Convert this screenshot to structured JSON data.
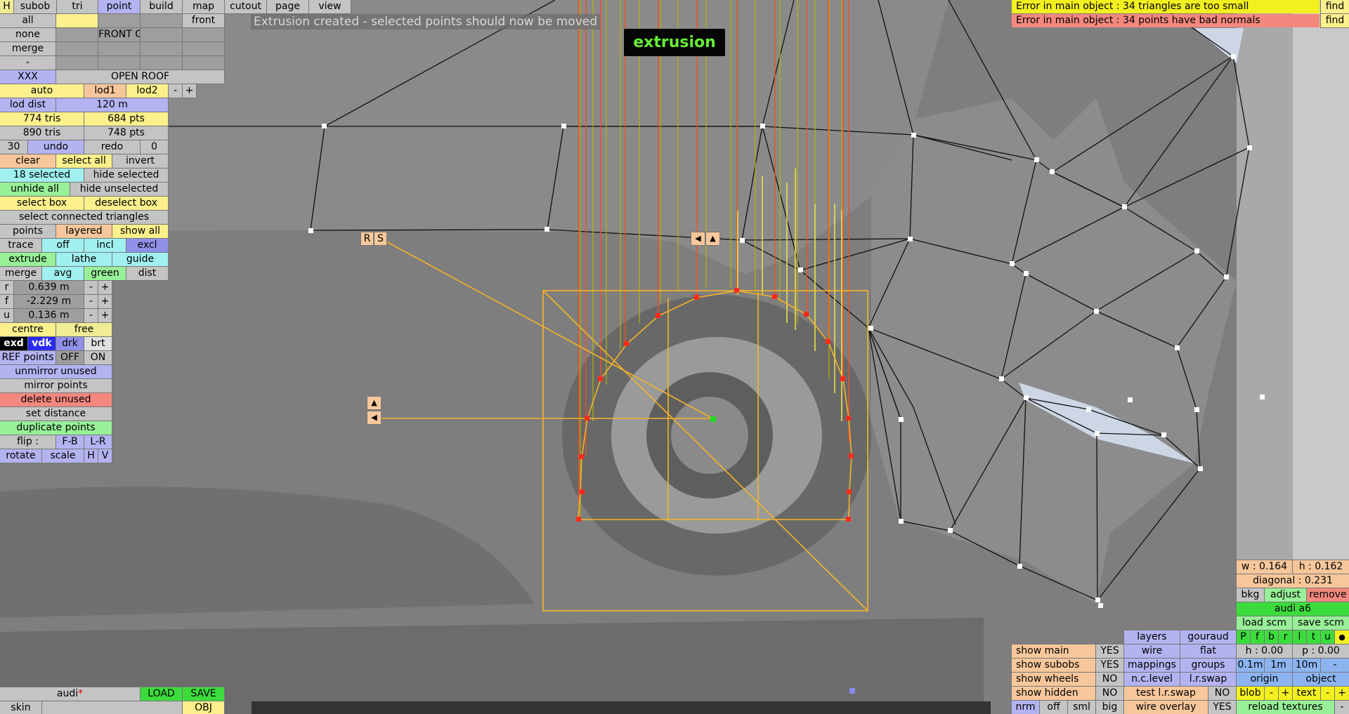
{
  "message": "Extrusion created - selected points should now be moved",
  "banner": "extrusion",
  "errors": [
    {
      "text": "Error in main object : 34 triangles are too small",
      "action": "find"
    },
    {
      "text": "Error in main object : 34 points have bad normals",
      "action": "find"
    }
  ],
  "menu": {
    "h": "H",
    "items": [
      "subob",
      "tri",
      "point",
      "build",
      "map",
      "cutout",
      "page",
      "view"
    ],
    "active": "point"
  },
  "selection_panel": {
    "all": "all",
    "none": "none",
    "merge": "merge",
    "dash": "-",
    "xxx": "XXX",
    "front": "front",
    "front_g": "FRONT G",
    "open_roof": "OPEN ROOF"
  },
  "lod": {
    "auto": "auto",
    "lod1": "lod1",
    "lod2": "lod2",
    "minus": "-",
    "plus": "+",
    "lod_dist_label": "lod dist",
    "lod_dist_value": "120 m"
  },
  "stats": {
    "tris1": "774 tris",
    "pts1": "684 pts",
    "tris2": "890 tris",
    "pts2": "748 pts"
  },
  "history": {
    "count": "30",
    "undo": "undo",
    "redo": "redo",
    "redo_count": "0"
  },
  "tools": {
    "clear": "clear",
    "select_all": "select all",
    "invert": "invert",
    "selected": "18 selected",
    "hide_selected": "hide selected",
    "unhide_all": "unhide all",
    "hide_unselected": "hide unselected",
    "select_box": "select box",
    "deselect_box": "deselect box",
    "select_connected": "select connected triangles",
    "points": "points",
    "layered": "layered",
    "show_all": "show all",
    "trace": "trace",
    "off": "off",
    "incl": "incl",
    "excl": "excl",
    "extrude": "extrude",
    "lathe": "lathe",
    "guide": "guide",
    "merge": "merge",
    "avg": "avg",
    "green": "green",
    "dist": "dist"
  },
  "coords": [
    {
      "axis": "r",
      "value": "0.639 m"
    },
    {
      "axis": "f",
      "value": "-2.229 m"
    },
    {
      "axis": "u",
      "value": "0.136 m"
    }
  ],
  "steppers": {
    "minus": "-",
    "plus": "+"
  },
  "pivot": {
    "centre": "centre",
    "free": "free"
  },
  "view_modes": {
    "exd": "exd",
    "vdk": "vdk",
    "drk": "drk",
    "brt": "brt"
  },
  "ref_points": {
    "label": "REF points",
    "off": "OFF",
    "on": "ON"
  },
  "ops": {
    "unmirror": "unmirror unused",
    "mirror": "mirror points",
    "delete": "delete unused",
    "set_distance": "set distance",
    "duplicate": "duplicate points",
    "flip": "flip :",
    "fb": "F-B",
    "lr": "L-R",
    "rotate": "rotate",
    "scale": "scale",
    "h": "H",
    "v": "V"
  },
  "handles": {
    "r": "R",
    "s": "S",
    "left": "◀",
    "up": "▲"
  },
  "file": {
    "name": "audi",
    "modified_mark": "*",
    "load": "LOAD",
    "save": "SAVE",
    "skin": "skin",
    "obj": "OBJ"
  },
  "selection_info": {
    "w": "w : 0.164",
    "h": "h : 0.162",
    "diagonal": "diagonal : 0.231",
    "bkg": "bkg",
    "adjust": "adjust",
    "remove": "remove",
    "model": "audi a6",
    "load_scm": "load scm",
    "save_scm": "save scm"
  },
  "render_modes": {
    "layers": "layers",
    "gouraud": "gouraud",
    "wire": "wire",
    "flat": "flat",
    "mappings": "mappings",
    "groups": "groups",
    "nc_level": "n.c.level",
    "lr_swap": "l.r.swap",
    "test_lr_swap": "test l.r.swap",
    "test_lr_swap_val": "NO",
    "wire_overlay": "wire overlay",
    "wire_overlay_val": "YES"
  },
  "show_toggles": [
    {
      "label": "show main",
      "value": "YES"
    },
    {
      "label": "show subobs",
      "value": "YES"
    },
    {
      "label": "show wheels",
      "value": "NO"
    },
    {
      "label": "show hidden",
      "value": "NO"
    }
  ],
  "normals": {
    "nrm": "nrm",
    "off": "off",
    "sml": "sml",
    "big": "big"
  },
  "pfbr": {
    "letters": [
      "P",
      "f",
      "b",
      "r",
      "l",
      "t",
      "u"
    ],
    "dot": "●"
  },
  "heights": {
    "h": "h : 0.00",
    "p": "p : 0.00",
    "steps": [
      "0.1m",
      "1m",
      "10m"
    ],
    "minus": "-"
  },
  "origin": {
    "origin": "origin",
    "object": "object"
  },
  "blob": {
    "blob": "blob",
    "minus": "-",
    "plus": "+",
    "text": "text"
  },
  "reload_textures": "reload textures",
  "reload_minus": "-"
}
